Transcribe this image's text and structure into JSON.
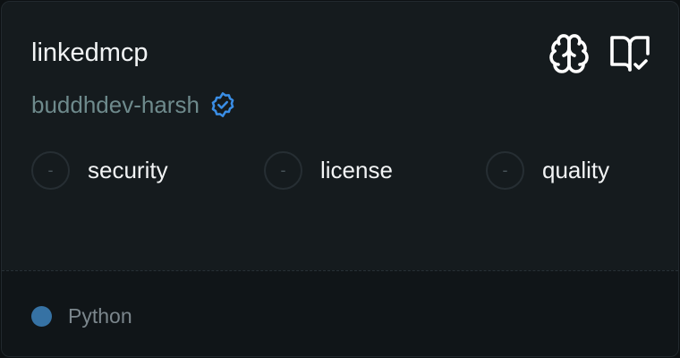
{
  "card": {
    "title": "linkedmcp",
    "author": "buddhdev-harsh",
    "verified_icon": "verified-badge-icon",
    "actions": {
      "brain_icon": "brain-icon",
      "docs_icon": "book-check-icon"
    }
  },
  "metrics": [
    {
      "score": "-",
      "label": "security"
    },
    {
      "score": "-",
      "label": "license"
    },
    {
      "score": "-",
      "label": "quality"
    }
  ],
  "footer": {
    "language": "Python",
    "language_color": "#3672a4"
  },
  "colors": {
    "background": "#151b1e",
    "title": "#f2f4f5",
    "author": "#6e8a8c",
    "verified_badge": "#3a8ee6"
  }
}
